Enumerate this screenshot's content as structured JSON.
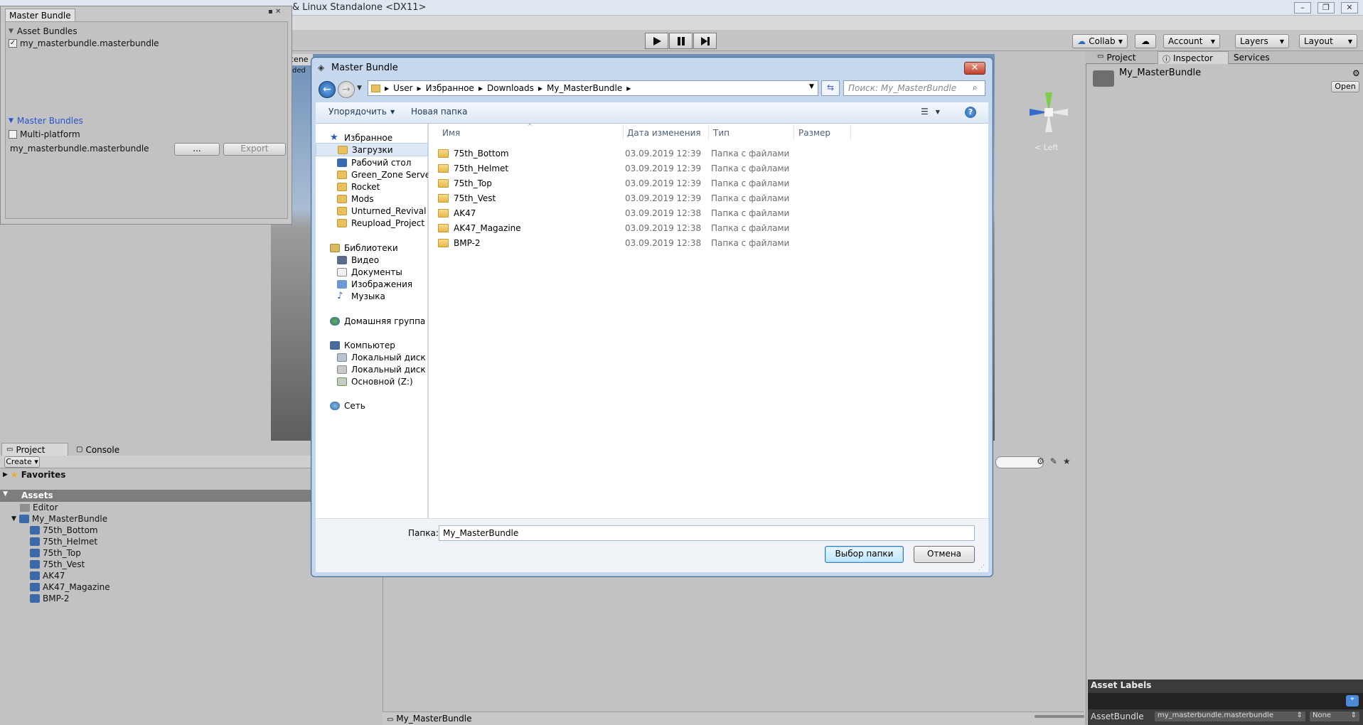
{
  "unity": {
    "title": "& Linux Standalone <DX11>",
    "collab_label": "Collab",
    "account_label": "Account",
    "layers_label": "Layers",
    "layout_label": "Layout",
    "scene_tab_fragment": "cene",
    "scene_fragment_2": "ded",
    "gizmo_label": "< Left"
  },
  "master_bundle": {
    "tab_title": "Master Bundle",
    "asset_bundles_header": "Asset Bundles",
    "asset_bundle_item": "my_masterbundle.masterbundle",
    "master_bundles_header": "Master Bundles",
    "multiplatform_label": "Multi-platform",
    "bundle_name": "my_masterbundle.masterbundle",
    "browse_label": "...",
    "export_label": "Export"
  },
  "project": {
    "tab_project": "Project",
    "tab_console": "Console",
    "create_label": "Create",
    "favorites_label": "Favorites",
    "assets_label": "Assets",
    "tree": [
      "Editor",
      "My_MasterBundle",
      "75th_Bottom",
      "75th_Helmet",
      "75th_Top",
      "75th_Vest",
      "AK47",
      "AK47_Magazine",
      "BMP-2"
    ],
    "footer_path": "My_MasterBundle"
  },
  "inspector": {
    "tab_project": "Project",
    "tab_inspector": "Inspector",
    "tab_services": "Services",
    "asset_name": "My_MasterBundle",
    "open_label": "Open",
    "asset_labels_header": "Asset Labels",
    "assetbundle_label": "AssetBundle",
    "assetbundle_value": "my_masterbundle.masterbundle",
    "variant_value": "None"
  },
  "dialog": {
    "title": "Master Bundle",
    "breadcrumb": [
      "User",
      "Избранное",
      "Downloads",
      "My_MasterBundle"
    ],
    "search_placeholder": "Поиск: My_MasterBundle",
    "organize_label": "Упорядочить",
    "new_folder_label": "Новая папка",
    "columns": [
      "Имя",
      "Дата изменения",
      "Тип",
      "Размер"
    ],
    "nav": {
      "favorites": "Избранное",
      "downloads": "Загрузки",
      "desktop": "Рабочий стол",
      "green_zone": "Green_Zone Server",
      "rocket": "Rocket",
      "mods": "Mods",
      "unturned": "Unturned_Revival",
      "reupload": "Reupload_Project",
      "libraries": "Библиотеки",
      "video": "Видео",
      "documents": "Документы",
      "images": "Изображения",
      "music": "Музыка",
      "homegroup": "Домашняя группа",
      "computer": "Компьютер",
      "disk_c": "Локальный диск (C",
      "disk_e": "Локальный диск (E:",
      "disk_z": "Основной (Z:)",
      "network": "Сеть"
    },
    "files": [
      {
        "name": "75th_Bottom",
        "date": "03.09.2019 12:39",
        "type": "Папка с файлами"
      },
      {
        "name": "75th_Helmet",
        "date": "03.09.2019 12:39",
        "type": "Папка с файлами"
      },
      {
        "name": "75th_Top",
        "date": "03.09.2019 12:39",
        "type": "Папка с файлами"
      },
      {
        "name": "75th_Vest",
        "date": "03.09.2019 12:39",
        "type": "Папка с файлами"
      },
      {
        "name": "AK47",
        "date": "03.09.2019 12:38",
        "type": "Папка с файлами"
      },
      {
        "name": "AK47_Magazine",
        "date": "03.09.2019 12:38",
        "type": "Папка с файлами"
      },
      {
        "name": "BMP-2",
        "date": "03.09.2019 12:38",
        "type": "Папка с файлами"
      }
    ],
    "folder_label": "Папка:",
    "folder_value": "My_MasterBundle",
    "select_button": "Выбор папки",
    "cancel_button": "Отмена"
  }
}
